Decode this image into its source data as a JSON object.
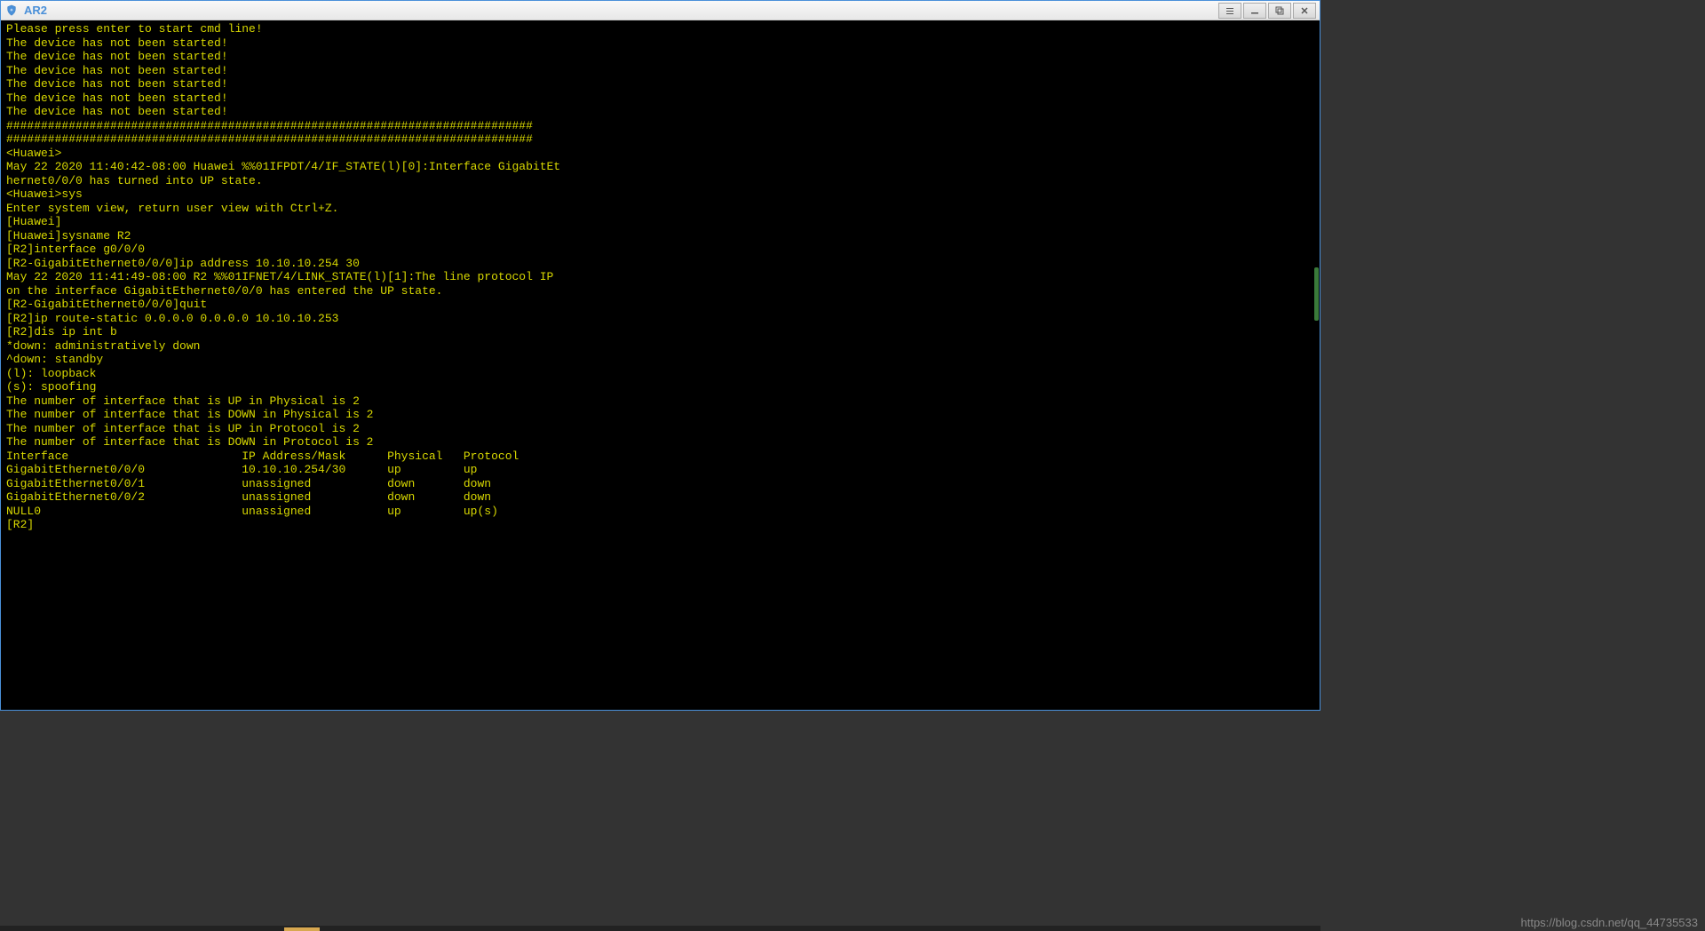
{
  "window": {
    "title": "AR2",
    "controls": {
      "menu_label": "menu",
      "minimize_label": "_",
      "maximize_label": "❐",
      "close_label": "X"
    }
  },
  "terminal_lines": [
    "Please press enter to start cmd line!",
    "The device has not been started!",
    "The device has not been started!",
    "The device has not been started!",
    "The device has not been started!",
    "The device has not been started!",
    "The device has not been started!",
    "############################################################################",
    "############################################################################",
    "<Huawei>",
    "May 22 2020 11:40:42-08:00 Huawei %%01IFPDT/4/IF_STATE(l)[0]:Interface GigabitEt",
    "hernet0/0/0 has turned into UP state.",
    "<Huawei>sys",
    "Enter system view, return user view with Ctrl+Z.",
    "[Huawei]",
    "[Huawei]sysname R2",
    "[R2]interface g0/0/0",
    "[R2-GigabitEthernet0/0/0]ip address 10.10.10.254 30",
    "May 22 2020 11:41:49-08:00 R2 %%01IFNET/4/LINK_STATE(l)[1]:The line protocol IP",
    "on the interface GigabitEthernet0/0/0 has entered the UP state.",
    "[R2-GigabitEthernet0/0/0]quit",
    "[R2]ip route-static 0.0.0.0 0.0.0.0 10.10.10.253",
    "[R2]dis ip int b",
    "*down: administratively down",
    "^down: standby",
    "(l): loopback",
    "(s): spoofing",
    "The number of interface that is UP in Physical is 2",
    "The number of interface that is DOWN in Physical is 2",
    "The number of interface that is UP in Protocol is 2",
    "The number of interface that is DOWN in Protocol is 2",
    "",
    "Interface                         IP Address/Mask      Physical   Protocol",
    "GigabitEthernet0/0/0              10.10.10.254/30      up         up",
    "GigabitEthernet0/0/1              unassigned           down       down",
    "GigabitEthernet0/0/2              unassigned           down       down",
    "NULL0                             unassigned           up         up(s)",
    "[R2]"
  ],
  "watermark": "https://blog.csdn.net/qq_44735533"
}
